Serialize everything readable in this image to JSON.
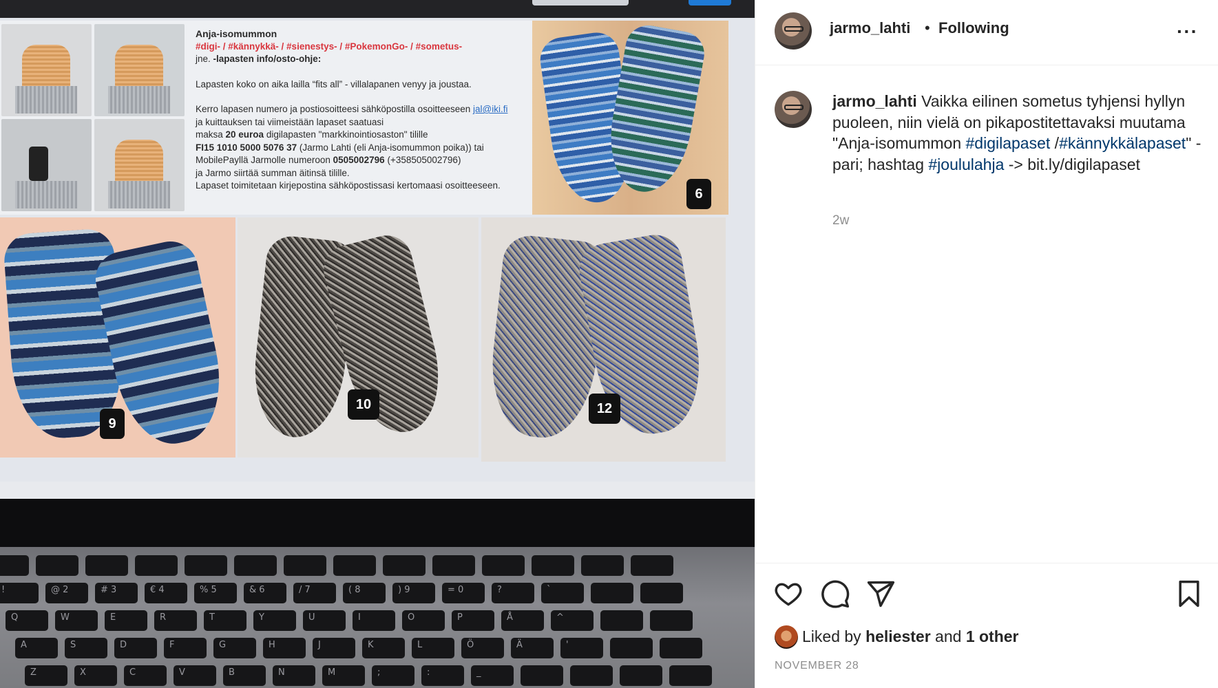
{
  "post": {
    "photo": {
      "info_panel": {
        "title": "Anja-isomummon",
        "tags": "#digi- / #kännykkä- / #sienestys- / #PokemonGo- / #sometus-",
        "subtitle_prefix": "jne.",
        "subtitle_bold": "-lapasten info/osto-ohje:",
        "size_note": "Lapasten koko on aika lailla “fits all” - villalapanen venyy ja joustaa.",
        "order_line1_prefix": "Kerro lapasen numero ja postiosoitteesi sähköpostilla osoitteeseen",
        "order_email": "jal@iki.fi",
        "order_line2": "ja kuittauksen tai viimeistään lapaset saatuasi",
        "order_line3_prefix": "maksa",
        "order_line3_bold": "20 euroa",
        "order_line3_suffix": "digilapasten \"markkinointiosaston\" tilille",
        "order_line4_bold": "FI15 1010 5000 5076 37",
        "order_line4_suffix": "(Jarmo Lahti (eli Anja-isomummon poika)) tai",
        "order_line5_prefix": "MobilePayllä Jarmolle numeroon",
        "order_line5_bold": "0505002796",
        "order_line5_suffix": "(+358505002796)",
        "order_line6": "ja Jarmo siirtää summan äitinsä tilille.",
        "order_line7": "Lapaset toimitetaan kirjepostina sähköpostissasi kertomaasi osoitteeseen."
      },
      "badges": {
        "top_right": "6",
        "bottom_left": "9",
        "bottom_middle": "10",
        "bottom_right": "12"
      },
      "keyboard_rows": [
        [
          "",
          "",
          "",
          "",
          "",
          "",
          "",
          "",
          "",
          "",
          "",
          "",
          "",
          ""
        ],
        [
          "!",
          "@ 2",
          "# 3",
          "€ 4",
          "% 5",
          "& 6",
          "/ 7",
          "( 8",
          ") 9",
          "= 0",
          "?",
          "`",
          "",
          ""
        ],
        [
          "Q",
          "W",
          "E",
          "R",
          "T",
          "Y",
          "U",
          "I",
          "O",
          "P",
          "Å",
          "^",
          "",
          ""
        ],
        [
          "A",
          "S",
          "D",
          "F",
          "G",
          "H",
          "J",
          "K",
          "L",
          "Ö",
          "Ä",
          "'",
          "",
          ""
        ],
        [
          "Z",
          "X",
          "C",
          "V",
          "B",
          "N",
          "M",
          ";",
          ":",
          "_",
          "",
          "",
          "",
          ""
        ]
      ]
    },
    "header": {
      "username": "jarmo_lahti",
      "separator": "•",
      "follow_status": "Following",
      "more": "···"
    },
    "caption": {
      "username": "jarmo_lahti",
      "text1": " Vaikka eilinen sometus tyhjensi hyllyn puoleen, niin vielä on pikapostitettavaksi muutama \"Anja-isomummon ",
      "tag1": "#digilapaset",
      "text2": " /",
      "tag2": "#kännykkälapaset",
      "text3": "\" -pari; hashtag ",
      "tag3": "#joululahja",
      "text4": " -> bit.ly/digilapaset",
      "time_ago": "2w"
    },
    "likes": {
      "prefix": "Liked by ",
      "user": "heliester",
      "middle": " and ",
      "others": "1 other"
    },
    "date": "NOVEMBER 28"
  }
}
